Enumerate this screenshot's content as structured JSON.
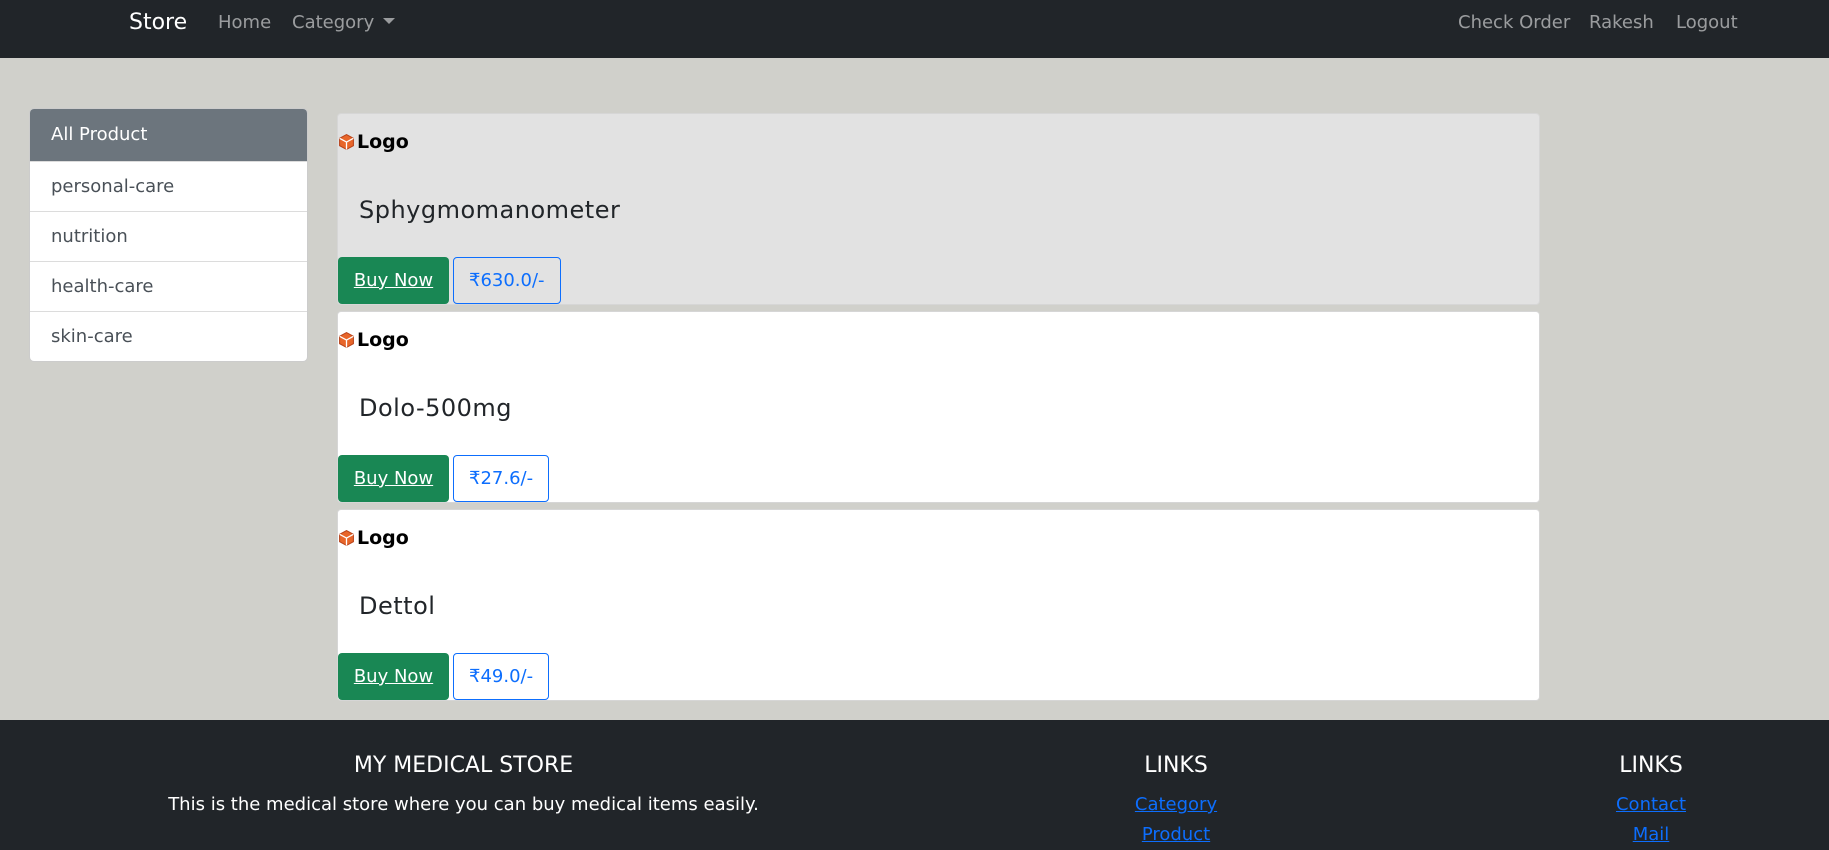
{
  "navbar": {
    "brand": "Store",
    "home": "Home",
    "category": "Category",
    "check_order": "Check Order",
    "user": "Rakesh",
    "logout": "Logout"
  },
  "sidebar": {
    "items": [
      {
        "label": "All Product",
        "active": true
      },
      {
        "label": "personal-care"
      },
      {
        "label": "nutrition"
      },
      {
        "label": "health-care"
      },
      {
        "label": "skin-care"
      }
    ]
  },
  "products": [
    {
      "logo_text": "Logo",
      "name": "Sphygmomanometer",
      "buy_label": "Buy Now",
      "price": "₹630.0/-"
    },
    {
      "logo_text": "Logo",
      "name": "Dolo-500mg",
      "buy_label": "Buy Now",
      "price": "₹27.6/-"
    },
    {
      "logo_text": "Logo",
      "name": "Dettol",
      "buy_label": "Buy Now",
      "price": "₹49.0/-"
    }
  ],
  "footer": {
    "store_title": "MY MEDICAL STORE",
    "store_desc": "This is the medical store where you can buy medical items easily.",
    "links1_title": "LINKS",
    "links1": [
      "Category",
      "Product"
    ],
    "links2_title": "LINKS",
    "links2": [
      "Contact",
      "Mail"
    ]
  },
  "colors": {
    "navbar_bg": "#212529",
    "page_bg": "#d0d0cb",
    "buy_button": "#198754",
    "price_outline": "#0d6efd",
    "sidebar_active": "#6c757d"
  },
  "icons": {
    "product_logo": "box-icon"
  }
}
